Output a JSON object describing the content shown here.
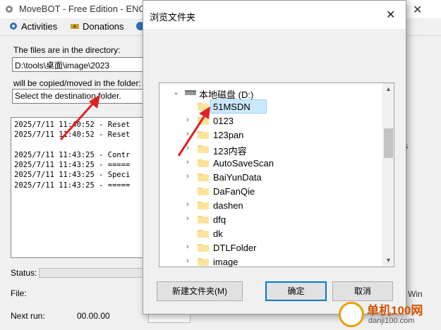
{
  "app": {
    "title": "MoveBOT - Free Edition - ENG",
    "menu": [
      {
        "label": "Activities",
        "icon": "gear-icon"
      },
      {
        "label": "Donations",
        "icon": "money-icon"
      }
    ]
  },
  "main": {
    "dir_label": "The files are in the directory:",
    "dir_value": "D:\\tools\\桌面\\image\\2023",
    "dest_label": "will be copied/moved in the folder:",
    "dest_value": "Select the destination folder.",
    "log": [
      "2025/7/11 11:40:52 - Reset",
      "2025/7/11 11:40:52 - Reset",
      "",
      "2025/7/11 11:43:25 - Contr",
      "2025/7/11 11:43:25 - =====",
      "2025/7/11 11:43:25 - Speci",
      "2025/7/11 11:43:25 - ====="
    ],
    "status_label": "Status:",
    "file_label": "File:",
    "next_run_label": "Next run:",
    "next_run_value": "00.00.00",
    "right_fragment_s": "s",
    "right_fragment_win": "Win"
  },
  "dialog": {
    "title": "浏览文件夹",
    "root": "本地磁盘 (D:)",
    "folders": [
      {
        "name": "51MSDN",
        "has_children": false,
        "selected": true
      },
      {
        "name": "0123",
        "has_children": true
      },
      {
        "name": "123pan",
        "has_children": true
      },
      {
        "name": "123内容",
        "has_children": true
      },
      {
        "name": "AutoSaveScan",
        "has_children": true
      },
      {
        "name": "BaiYunData",
        "has_children": true
      },
      {
        "name": "DaFanQie",
        "has_children": false
      },
      {
        "name": "dashen",
        "has_children": true
      },
      {
        "name": "dfq",
        "has_children": true
      },
      {
        "name": "dk",
        "has_children": false
      },
      {
        "name": "DTLFolder",
        "has_children": true
      },
      {
        "name": "image",
        "has_children": true
      }
    ],
    "buttons": {
      "new_folder": "新建文件夹(M)",
      "ok": "确定",
      "cancel": "取消"
    }
  },
  "watermark": {
    "text": "单机100网",
    "url": "danji100.com"
  },
  "colors": {
    "selection": "#cce8ff",
    "folder": "#f8d775",
    "arrow": "#e02020",
    "accent": "#0078d7"
  }
}
